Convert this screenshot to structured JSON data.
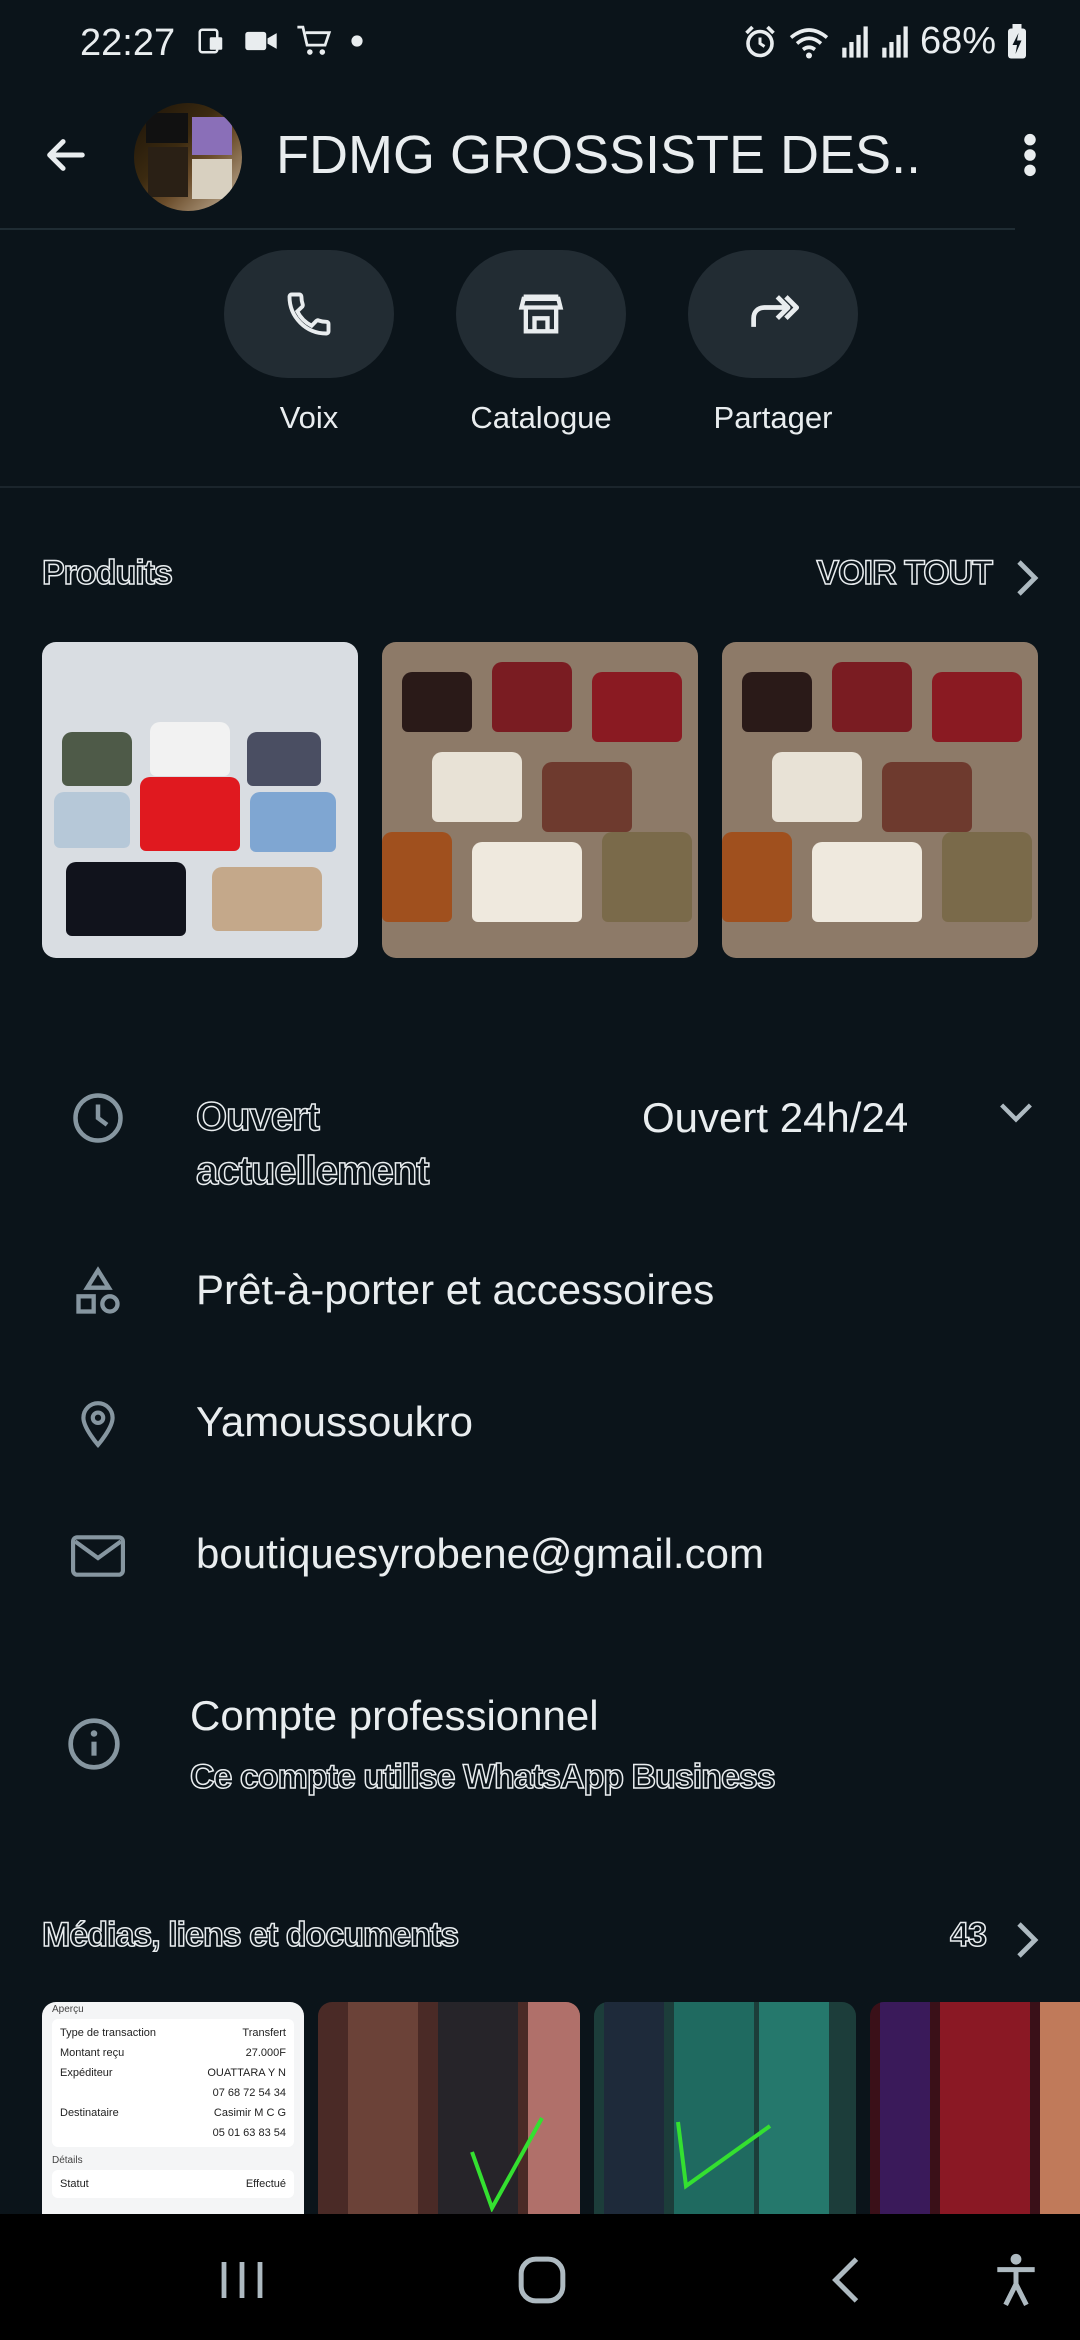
{
  "status": {
    "time": "22:27",
    "battery": "68%",
    "left_icons": [
      "screenshot-icon",
      "video-icon",
      "cart-icon",
      "dot-icon"
    ],
    "right_icons": [
      "alarm-icon",
      "wifi-icon",
      "signal-icon",
      "signal-icon",
      "battery-charging-icon"
    ]
  },
  "header": {
    "title": "FDMG GROSSISTE DES..."
  },
  "actions": [
    {
      "label": "Voix",
      "icon": "phone-icon"
    },
    {
      "label": "Catalogue",
      "icon": "store-icon"
    },
    {
      "label": "Partager",
      "icon": "share-icon"
    }
  ],
  "products": {
    "title": "Produits",
    "link": "VOIR TOUT"
  },
  "info": {
    "hours_label": "Ouvert actuellement",
    "hours_value": "Ouvert 24h/24",
    "category": "Prêt-à-porter et accessoires",
    "location": "Yamoussoukro",
    "email": "boutiquesyrobene@gmail.com",
    "account_title": "Compte professionnel",
    "account_subtitle": "Ce compte utilise WhatsApp Business"
  },
  "media": {
    "title": "Médias, liens et documents",
    "count": "43",
    "receipt": {
      "heading": "Aperçu",
      "rows": [
        {
          "k": "Type de transaction",
          "v": "Transfert"
        },
        {
          "k": "Montant reçu",
          "v": "27.000F"
        },
        {
          "k": "Expéditeur",
          "v": "OUATTARA Y N"
        },
        {
          "k": "",
          "v": "07 68 72 54 34"
        },
        {
          "k": "Destinataire",
          "v": "Casimir M C G"
        },
        {
          "k": "",
          "v": "05 01 63 83 54"
        }
      ],
      "details": "Détails",
      "status_k": "Statut",
      "status_v": "Effectué"
    }
  }
}
